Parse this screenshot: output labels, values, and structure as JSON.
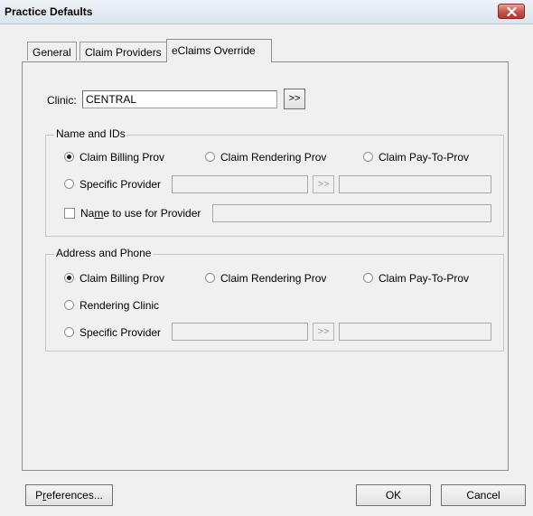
{
  "window": {
    "title": "Practice Defaults"
  },
  "tabs": [
    {
      "label": "General"
    },
    {
      "label": "Claim Providers"
    },
    {
      "label": "eClaims Override"
    }
  ],
  "clinic": {
    "label": "Clinic:",
    "value": "CENTRAL",
    "browse_label": ">>"
  },
  "name_ids": {
    "legend": "Name and IDs",
    "opt_billing": "Claim Billing Prov",
    "opt_rendering": "Claim Rendering Prov",
    "opt_payto": "Claim Pay-To-Prov",
    "opt_specific": "Specific Provider",
    "browse_label": ">>",
    "name_check_pre": "Na",
    "name_check_m": "m",
    "name_check_post": "e to use for Provider"
  },
  "address_phone": {
    "legend": "Address and Phone",
    "opt_billing": "Claim Billing Prov",
    "opt_rendering": "Claim Rendering Prov",
    "opt_payto": "Claim Pay-To-Prov",
    "opt_clinic": "Rendering Clinic",
    "opt_specific": "Specific Provider",
    "browse_label": ">>"
  },
  "footer": {
    "pref_pre": "P",
    "pref_r": "r",
    "pref_post": "eferences...",
    "ok": "OK",
    "cancel": "Cancel"
  },
  "colors": {
    "close_button": "#c75050",
    "dialog_bg": "#f0f0f0"
  }
}
